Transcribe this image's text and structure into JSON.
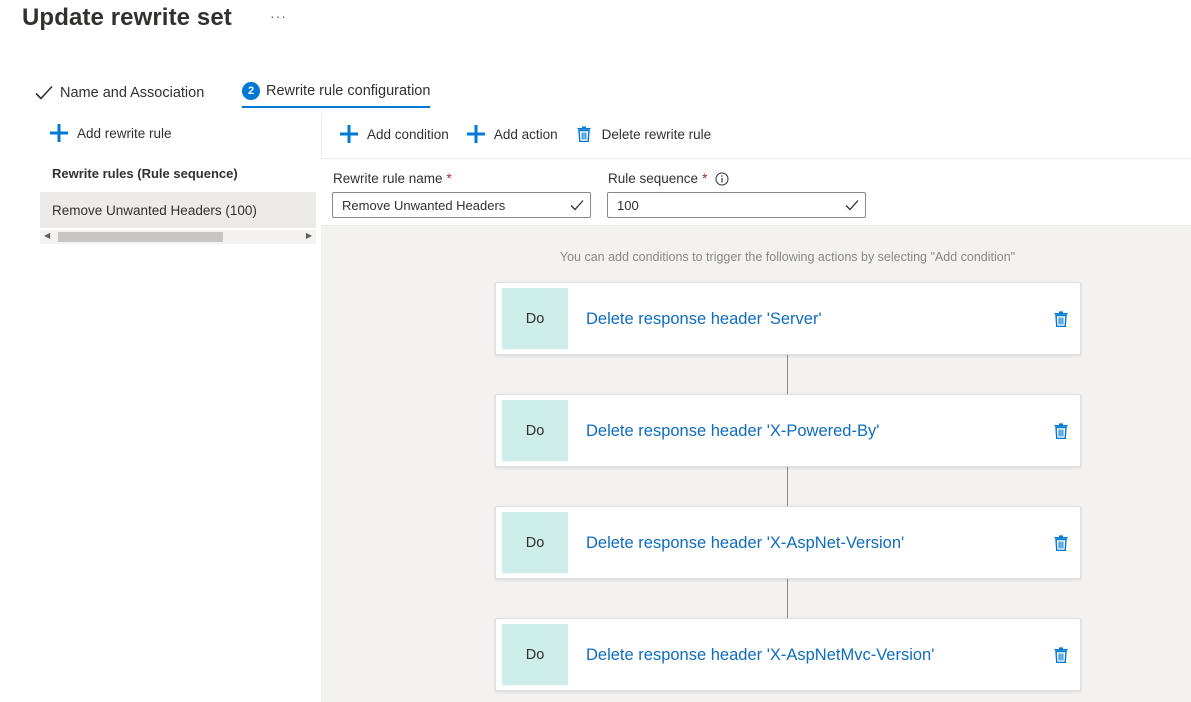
{
  "header": {
    "title": "Update rewrite set",
    "more": "···"
  },
  "steps": [
    {
      "label": "Name and Association",
      "state": "completed"
    },
    {
      "number": "2",
      "label": "Rewrite rule configuration",
      "state": "active"
    }
  ],
  "left_panel": {
    "add_rule_label": "Add rewrite rule",
    "rules_header": "Rewrite rules (Rule sequence)",
    "rules": [
      {
        "label": "Remove Unwanted Headers (100)"
      }
    ]
  },
  "toolbar": {
    "add_condition": "Add condition",
    "add_action": "Add action",
    "delete_rule": "Delete rewrite rule"
  },
  "form": {
    "rule_name_label": "Rewrite rule name",
    "rule_name_value": "Remove Unwanted Headers",
    "rule_sequence_label": "Rule sequence",
    "rule_sequence_value": "100",
    "required_mark": "*"
  },
  "canvas": {
    "hint": "You can add conditions to trigger the following actions by selecting \"Add condition\"",
    "actions": [
      {
        "tag": "Do",
        "label": "Delete response header 'Server'"
      },
      {
        "tag": "Do",
        "label": "Delete response header 'X-Powered-By'"
      },
      {
        "tag": "Do",
        "label": "Delete response header 'X-AspNet-Version'"
      },
      {
        "tag": "Do",
        "label": "Delete response header 'X-AspNetMvc-Version'"
      }
    ]
  },
  "colors": {
    "accent": "#0078d4",
    "link": "#0f6cbd",
    "do_block": "#cdeee9",
    "canvas_bg": "#f3f2f1",
    "required": "#a4262c"
  },
  "icons": [
    "checkmark-icon",
    "plus-icon",
    "trash-icon",
    "info-icon",
    "chevron-left-icon",
    "chevron-right-icon"
  ]
}
